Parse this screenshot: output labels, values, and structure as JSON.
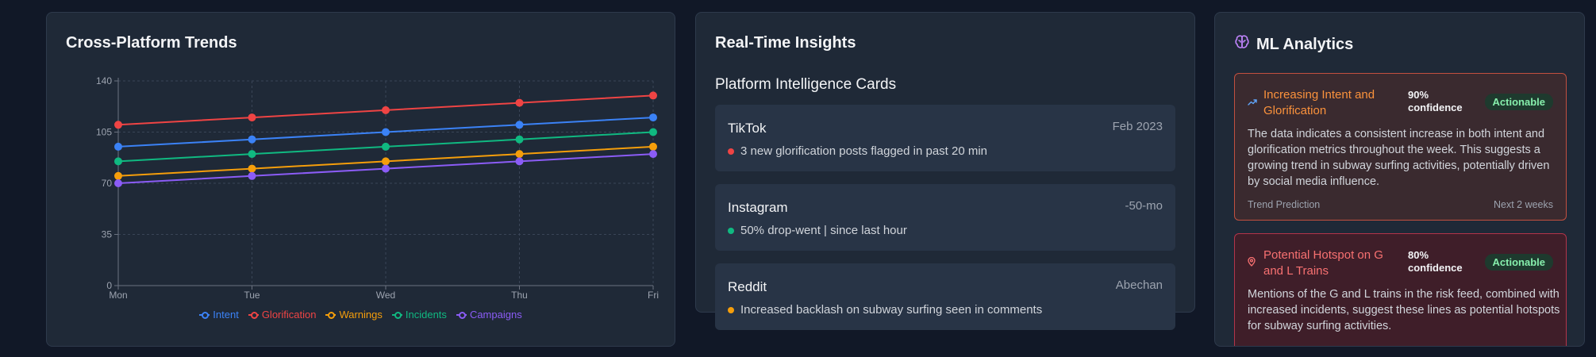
{
  "trends": {
    "title": "Cross-Platform Trends",
    "chart_data": {
      "type": "line",
      "categories": [
        "Mon",
        "Tue",
        "Wed",
        "Thu",
        "Fri"
      ],
      "y_ticks": [
        "0",
        "35",
        "70",
        "105",
        "140"
      ],
      "ylim": [
        0,
        140
      ],
      "grid": true,
      "legend_position": "bottom",
      "series": [
        {
          "name": "Intent",
          "color": "#3b82f6",
          "values": [
            95,
            100,
            105,
            110,
            115
          ]
        },
        {
          "name": "Glorification",
          "color": "#ef4444",
          "values": [
            110,
            115,
            120,
            125,
            130
          ]
        },
        {
          "name": "Warnings",
          "color": "#f59e0b",
          "values": [
            75,
            80,
            85,
            90,
            95
          ]
        },
        {
          "name": "Incidents",
          "color": "#10b981",
          "values": [
            85,
            90,
            95,
            100,
            105
          ]
        },
        {
          "name": "Campaigns",
          "color": "#8b5cf6",
          "values": [
            70,
            75,
            80,
            85,
            90
          ]
        }
      ]
    }
  },
  "insights": {
    "title": "Real-Time Insights",
    "section_title": "Platform Intelligence Cards",
    "cards": [
      {
        "platform": "TikTok",
        "meta": "Feb 2023",
        "dot_color": "#ef4444",
        "text": "3 new glorification posts flagged in past 20 min"
      },
      {
        "platform": "Instagram",
        "meta": "-50-mo",
        "dot_color": "#10b981",
        "text": "50% drop-went | since last hour"
      },
      {
        "platform": "Reddit",
        "meta": "Abechan",
        "dot_color": "#f59e0b",
        "text": "Increased backlash on subway surfing seen in comments"
      }
    ]
  },
  "ml": {
    "title": "ML Analytics",
    "title_icon": "brain-icon",
    "cards": [
      {
        "icon": "trending-up-icon",
        "title": "Increasing Intent and Glorification",
        "title_color": "#fb923c",
        "confidence": "90% confidence",
        "badge": "Actionable",
        "body": "The data indicates a consistent increase in both intent and glorification metrics throughout the week. This suggests a growing trend in subway surfing activities, potentially driven by social media influence.",
        "footer_left": "Trend Prediction",
        "footer_right": "Next 2 weeks"
      },
      {
        "icon": "map-pin-icon",
        "title": "Potential Hotspot on G and L Trains",
        "title_color": "#f87171",
        "confidence": "80% confidence",
        "badge": "Actionable",
        "body": "Mentions of the G and L trains in the risk feed, combined with increased incidents, suggest these lines as potential hotspots for subway surfing activities."
      }
    ]
  }
}
